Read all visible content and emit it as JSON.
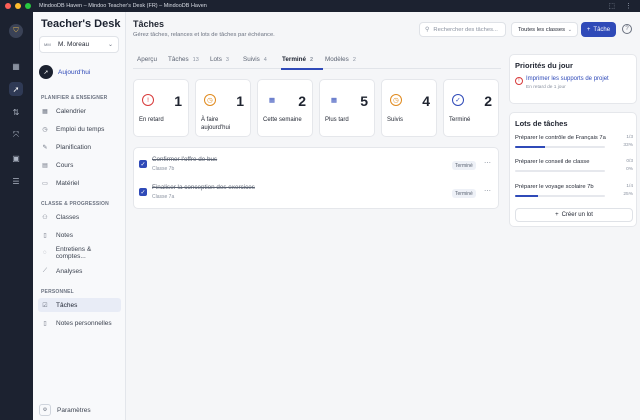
{
  "window": {
    "title": "MindooDB Haven – Mindoo Teacher's Desk (FR) – MindooDB Haven"
  },
  "brand": "Teacher's Desk",
  "user": {
    "initials": "MM",
    "name": "M. Moreau"
  },
  "today": {
    "label": "Aujourd'hui"
  },
  "sections": {
    "plan": "PLANIFIER & ENSEIGNER",
    "class": "CLASSE & PROGRESSION",
    "personal": "PERSONNEL"
  },
  "nav": {
    "calendar": "Calendrier",
    "schedule": "Emploi du temps",
    "planning": "Planification",
    "courses": "Cours",
    "material": "Matériel",
    "classes": "Classes",
    "grades": "Notes",
    "meetings": "Entretiens & comptes...",
    "analyses": "Analyses",
    "tasks": "Tâches",
    "notes": "Notes personnelles",
    "settings": "Paramètres"
  },
  "page": {
    "title": "Tâches",
    "subtitle": "Gérez tâches, relances et lots de tâches par échéance."
  },
  "search": {
    "placeholder": "Rechercher des tâches..."
  },
  "class_filter": {
    "value": "Toutes les classes"
  },
  "add_button": {
    "label": "Tâche"
  },
  "tabs": [
    {
      "label": "Aperçu",
      "count": ""
    },
    {
      "label": "Tâches",
      "count": "13"
    },
    {
      "label": "Lots",
      "count": "3"
    },
    {
      "label": "Suivis",
      "count": "4"
    },
    {
      "label": "Terminé",
      "count": "2"
    },
    {
      "label": "Modèles",
      "count": "2"
    }
  ],
  "stats": [
    {
      "label": "En retard",
      "value": "1",
      "color": "#d83b3b"
    },
    {
      "label": "À faire aujourd'hui",
      "value": "1",
      "color": "#e08a1e"
    },
    {
      "label": "Cette semaine",
      "value": "2",
      "color": "#2f4ab8"
    },
    {
      "label": "Plus tard",
      "value": "5",
      "color": "#2f4ab8"
    },
    {
      "label": "Suivis",
      "value": "4",
      "color": "#e08a1e"
    },
    {
      "label": "Terminé",
      "value": "2",
      "color": "#2f4ab8"
    }
  ],
  "tasks": [
    {
      "title": "Confirmer l'offre de bus",
      "class": "Classe 7b",
      "status": "Terminé"
    },
    {
      "title": "Finaliser la conception des exercices",
      "class": "Classe 7a",
      "status": "Terminé"
    }
  ],
  "priorities": {
    "title": "Priorités du jour",
    "item": {
      "title": "Imprimer les supports de projet",
      "sub": "En retard de 1 jour"
    }
  },
  "lots": {
    "title": "Lots de tâches",
    "items": [
      {
        "name": "Préparer le contrôle de Français 7a",
        "count": "1/3",
        "percent": "33%",
        "progress": 0.33
      },
      {
        "name": "Préparer le conseil de classe",
        "count": "0/3",
        "percent": "0%",
        "progress": 0.0
      },
      {
        "name": "Préparer le voyage scolaire 7b",
        "count": "1/4",
        "percent": "25%",
        "progress": 0.25
      }
    ],
    "create_label": "Créer un lot"
  }
}
